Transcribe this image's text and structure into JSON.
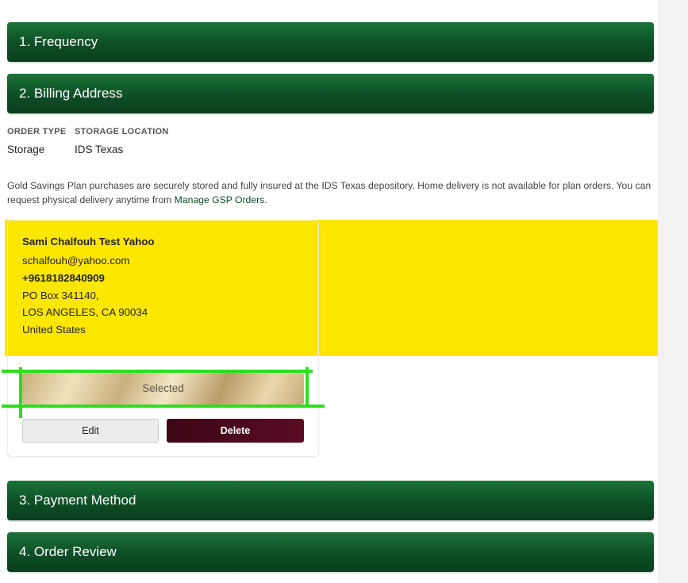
{
  "steps": {
    "frequency": "1. Frequency",
    "billing_address": "2. Billing Address",
    "payment_method": "3. Payment Method",
    "order_review": "4. Order Review"
  },
  "order_info": {
    "order_type_label": "ORDER TYPE",
    "order_type_value": "Storage",
    "storage_location_label": "STORAGE LOCATION",
    "storage_location_value": "IDS Texas"
  },
  "notice": {
    "text": "Gold Savings Plan purchases are securely stored and fully insured at the IDS Texas depository. Home delivery is not available for plan orders. You can request physical delivery anytime from ",
    "link": "Manage GSP Orders",
    "suffix": "."
  },
  "address_card": {
    "name": "Sami Chalfouh Test Yahoo",
    "email": "schalfouh@yahoo.com",
    "phone": "+9618182840909",
    "line1": "PO Box 341140,",
    "line2": "LOS ANGELES, CA 90034",
    "country": "United States",
    "selected_label": "Selected",
    "edit_label": "Edit",
    "delete_label": "Delete"
  },
  "colors": {
    "header_green": "#0e4e26",
    "highlight_yellow": "#fde700",
    "annotation_green": "#2fdc1f",
    "delete_maroon": "#4a0a1d"
  }
}
